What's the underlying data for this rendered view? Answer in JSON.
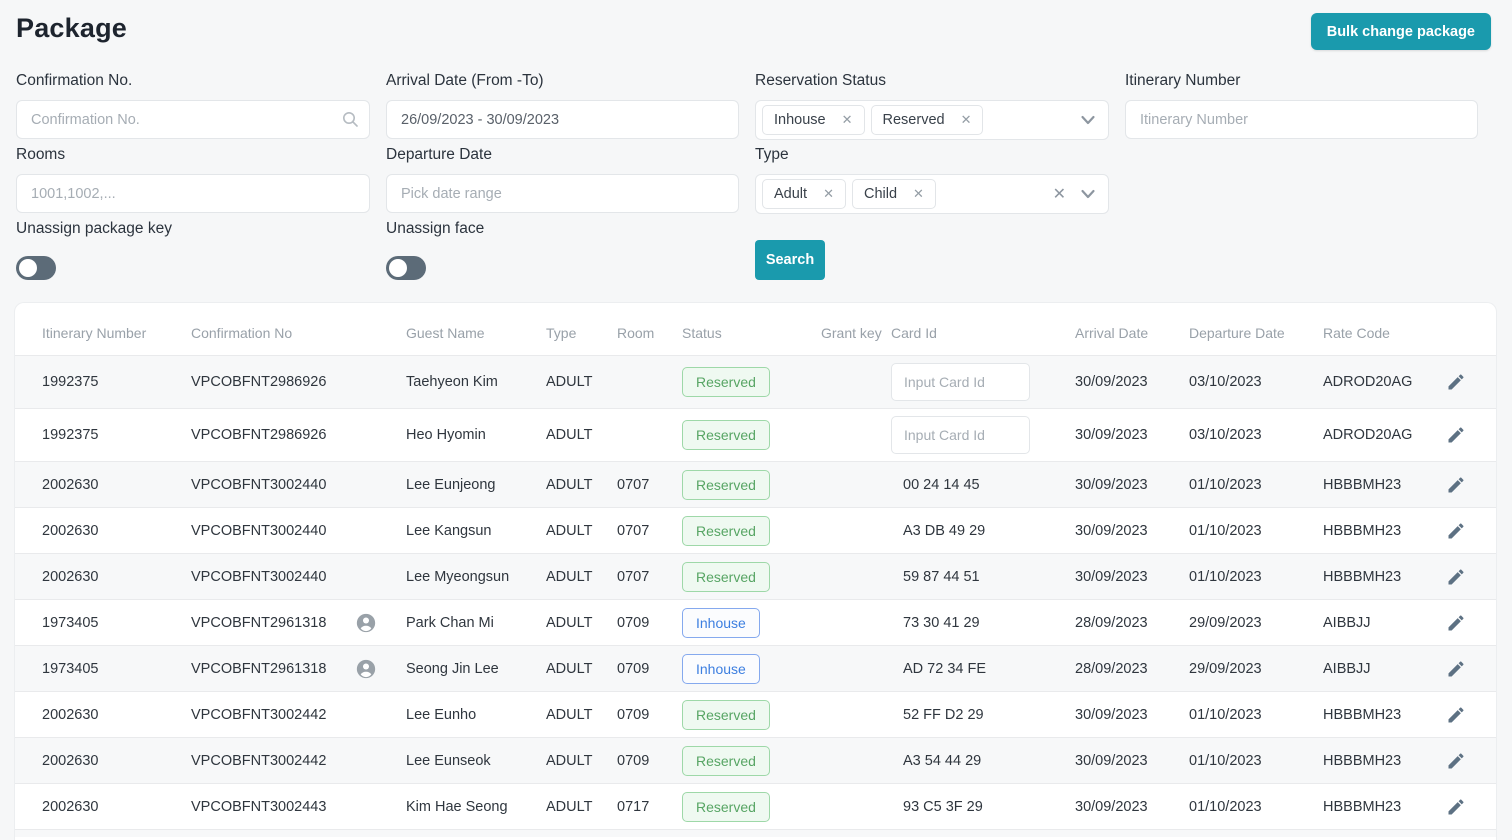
{
  "page": {
    "title": "Package"
  },
  "toolbar": {
    "bulk_change_label": "Bulk change package"
  },
  "icons": {
    "remove_x": "✕",
    "clear_x": "✕"
  },
  "colors": {
    "accent_teal": "#1a9aad",
    "link_blue": "#4a8fd4",
    "reserved_green": "#57a564",
    "inhouse_blue": "#3d7fe0",
    "toggle_slate": "#5c6b78"
  },
  "filters": {
    "confirmation_no": {
      "label": "Confirmation No.",
      "placeholder": "Confirmation No."
    },
    "arrival_date": {
      "label": "Arrival Date (From -To)",
      "value": "26/09/2023 - 30/09/2023"
    },
    "reservation_status": {
      "label": "Reservation Status",
      "selected": [
        {
          "label": "Inhouse"
        },
        {
          "label": "Reserved"
        }
      ]
    },
    "itinerary_number": {
      "label": "Itinerary Number",
      "placeholder": "Itinerary Number"
    },
    "rooms": {
      "label": "Rooms",
      "placeholder": "1001,1002,..."
    },
    "departure_date": {
      "label": "Departure Date",
      "placeholder": "Pick date range"
    },
    "type": {
      "label": "Type",
      "selected": [
        {
          "label": "Adult"
        },
        {
          "label": "Child"
        }
      ]
    },
    "unassign_package_key": {
      "label": "Unassign package key",
      "on": false
    },
    "unassign_face": {
      "label": "Unassign face",
      "on": false
    },
    "search_label": "Search"
  },
  "table": {
    "columns": [
      "Itinerary Number",
      "Confirmation No",
      "",
      "Guest Name",
      "Type",
      "Room",
      "Status",
      "Grant key",
      "Card Id",
      "Arrival Date",
      "Departure Date",
      "Rate Code",
      ""
    ],
    "rows": [
      {
        "itinerary": "1992375",
        "confirmation": "VPCOBFNT2986926",
        "avatar": false,
        "guest": "Taehyeon Kim",
        "type": "ADULT",
        "room": "",
        "status": "Reserved",
        "card_type": "input",
        "card_placeholder": "Input Card Id",
        "card_id": "",
        "arrival": "30/09/2023",
        "departure": "03/10/2023",
        "rate": "ADROD20AG"
      },
      {
        "itinerary": "1992375",
        "confirmation": "VPCOBFNT2986926",
        "avatar": false,
        "guest": "Heo Hyomin",
        "type": "ADULT",
        "room": "",
        "status": "Reserved",
        "card_type": "input",
        "card_placeholder": "Input Card Id",
        "card_id": "",
        "arrival": "30/09/2023",
        "departure": "03/10/2023",
        "rate": "ADROD20AG"
      },
      {
        "itinerary": "2002630",
        "confirmation": "VPCOBFNT3002440",
        "avatar": false,
        "guest": "Lee Eunjeong",
        "type": "ADULT",
        "room": "0707",
        "status": "Reserved",
        "card_type": "text",
        "card_placeholder": "",
        "card_id": "00 24 14 45",
        "arrival": "30/09/2023",
        "departure": "01/10/2023",
        "rate": "HBBBMH23"
      },
      {
        "itinerary": "2002630",
        "confirmation": "VPCOBFNT3002440",
        "avatar": false,
        "guest": "Lee Kangsun",
        "type": "ADULT",
        "room": "0707",
        "status": "Reserved",
        "card_type": "text",
        "card_placeholder": "",
        "card_id": "A3 DB 49 29",
        "arrival": "30/09/2023",
        "departure": "01/10/2023",
        "rate": "HBBBMH23"
      },
      {
        "itinerary": "2002630",
        "confirmation": "VPCOBFNT3002440",
        "avatar": false,
        "guest": "Lee Myeongsun",
        "type": "ADULT",
        "room": "0707",
        "status": "Reserved",
        "card_type": "text",
        "card_placeholder": "",
        "card_id": "59 87 44 51",
        "arrival": "30/09/2023",
        "departure": "01/10/2023",
        "rate": "HBBBMH23"
      },
      {
        "itinerary": "1973405",
        "confirmation": "VPCOBFNT2961318",
        "avatar": true,
        "guest": "Park Chan Mi",
        "type": "ADULT",
        "room": "0709",
        "status": "Inhouse",
        "card_type": "text",
        "card_placeholder": "",
        "card_id": "73 30 41 29",
        "arrival": "28/09/2023",
        "departure": "29/09/2023",
        "rate": "AIBBJJ"
      },
      {
        "itinerary": "1973405",
        "confirmation": "VPCOBFNT2961318",
        "avatar": true,
        "guest": "Seong Jin Lee",
        "type": "ADULT",
        "room": "0709",
        "status": "Inhouse",
        "card_type": "text",
        "card_placeholder": "",
        "card_id": "AD 72 34 FE",
        "arrival": "28/09/2023",
        "departure": "29/09/2023",
        "rate": "AIBBJJ"
      },
      {
        "itinerary": "2002630",
        "confirmation": "VPCOBFNT3002442",
        "avatar": false,
        "guest": "Lee Eunho",
        "type": "ADULT",
        "room": "0709",
        "status": "Reserved",
        "card_type": "text",
        "card_placeholder": "",
        "card_id": "52 FF D2 29",
        "arrival": "30/09/2023",
        "departure": "01/10/2023",
        "rate": "HBBBMH23"
      },
      {
        "itinerary": "2002630",
        "confirmation": "VPCOBFNT3002442",
        "avatar": false,
        "guest": "Lee Eunseok",
        "type": "ADULT",
        "room": "0709",
        "status": "Reserved",
        "card_type": "text",
        "card_placeholder": "",
        "card_id": "A3 54 44 29",
        "arrival": "30/09/2023",
        "departure": "01/10/2023",
        "rate": "HBBBMH23"
      },
      {
        "itinerary": "2002630",
        "confirmation": "VPCOBFNT3002443",
        "avatar": false,
        "guest": "Kim Hae Seong",
        "type": "ADULT",
        "room": "0717",
        "status": "Reserved",
        "card_type": "text",
        "card_placeholder": "",
        "card_id": "93 C5 3F 29",
        "arrival": "30/09/2023",
        "departure": "01/10/2023",
        "rate": "HBBBMH23"
      }
    ]
  }
}
